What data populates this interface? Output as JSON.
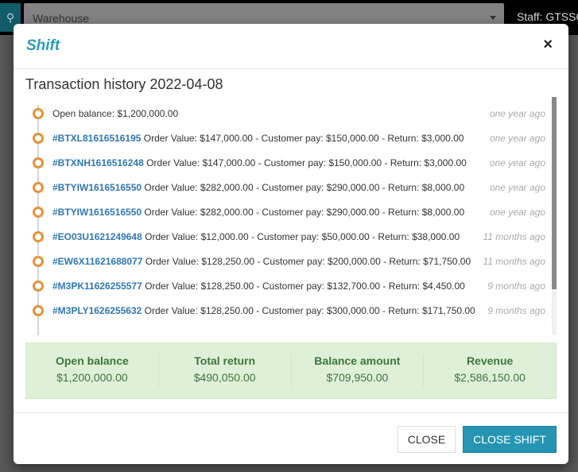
{
  "background": {
    "search_icon": "search-icon",
    "warehouse_select": "Warehouse",
    "staff_label": "Staff: GTSSC"
  },
  "modal": {
    "title": "Shift",
    "close_icon": "×",
    "history_title": "Transaction history 2022-04-08",
    "timeline": [
      {
        "code": "",
        "text": "Open balance: $1,200,000.00",
        "time": "one year ago"
      },
      {
        "code": "#BTXL81616516195",
        "text": "Order Value: $147,000.00 - Customer pay: $150,000.00 - Return: $3,000.00",
        "time": "one year ago"
      },
      {
        "code": "#BTXNH1616516248",
        "text": "Order Value: $147,000.00 - Customer pay: $150,000.00 - Return: $3,000.00",
        "time": "one year ago"
      },
      {
        "code": "#BTYIW1616516550",
        "text": "Order Value: $282,000.00 - Customer pay: $290,000.00 - Return: $8,000.00",
        "time": "one year ago"
      },
      {
        "code": "#BTYIW1616516550",
        "text": "Order Value: $282,000.00 - Customer pay: $290,000.00 - Return: $8,000.00",
        "time": "one year ago"
      },
      {
        "code": "#EO03U1621249648",
        "text": "Order Value: $12,000.00 - Customer pay: $50,000.00 - Return: $38,000.00",
        "time": "11 months ago"
      },
      {
        "code": "#EW6X11621688077",
        "text": "Order Value: $128,250.00 - Customer pay: $200,000.00 - Return: $71,750.00",
        "time": "11 months ago"
      },
      {
        "code": "#M3PK11626255577",
        "text": "Order Value: $128,250.00 - Customer pay: $132,700.00 - Return: $4,450.00",
        "time": "9 months ago"
      },
      {
        "code": "#M3PLY1626255632",
        "text": "Order Value: $128,250.00 - Customer pay: $300,000.00 - Return: $171,750.00",
        "time": "9 months ago"
      }
    ],
    "summary": [
      {
        "label": "Open balance",
        "value": "$1,200,000.00"
      },
      {
        "label": "Total return",
        "value": "$490,050.00"
      },
      {
        "label": "Balance amount",
        "value": "$709,950.00"
      },
      {
        "label": "Revenue",
        "value": "$2,586,150.00"
      }
    ],
    "footer": {
      "close_label": "CLOSE",
      "close_shift_label": "CLOSE SHIFT"
    }
  },
  "colors": {
    "accent": "#2b9bb5",
    "primary_button": "#2595b3",
    "timeline_dot": "#e8913a",
    "order_code": "#2f78b5",
    "summary_bg": "#dff0d8",
    "summary_text": "#3c763d"
  }
}
